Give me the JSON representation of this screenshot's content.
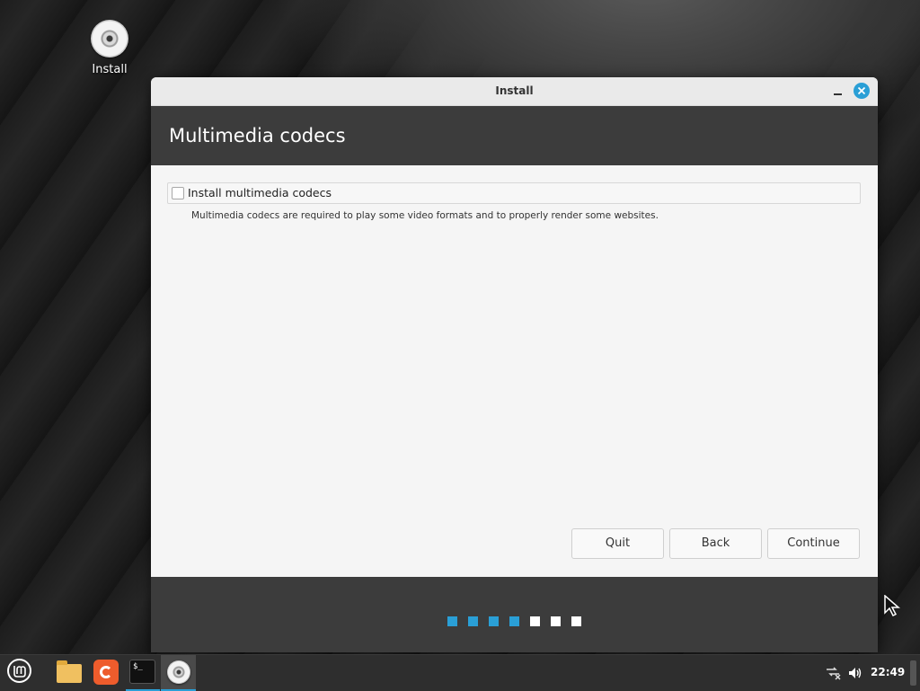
{
  "desktop": {
    "icon_label": "Install"
  },
  "window": {
    "title": "Install",
    "heading": "Multimedia codecs",
    "codecs_option": {
      "label": "Install multimedia codecs",
      "checked": false,
      "description": "Multimedia codecs are required to play some video formats and to properly render some websites."
    },
    "buttons": {
      "quit": "Quit",
      "back": "Back",
      "continue": "Continue"
    },
    "progress": {
      "completed_steps": 4,
      "total_steps": 7
    }
  },
  "taskbar": {
    "launchers": [
      "mint-menu-icon",
      "folder-icon",
      "firefox-icon",
      "terminal-icon",
      "disc-icon"
    ],
    "terminal_glyph": "$_",
    "clock": "22:49"
  },
  "colors": {
    "accent": "#2a9fd6",
    "header_bg": "#3c3c3c",
    "window_bg": "#f5f5f5"
  }
}
